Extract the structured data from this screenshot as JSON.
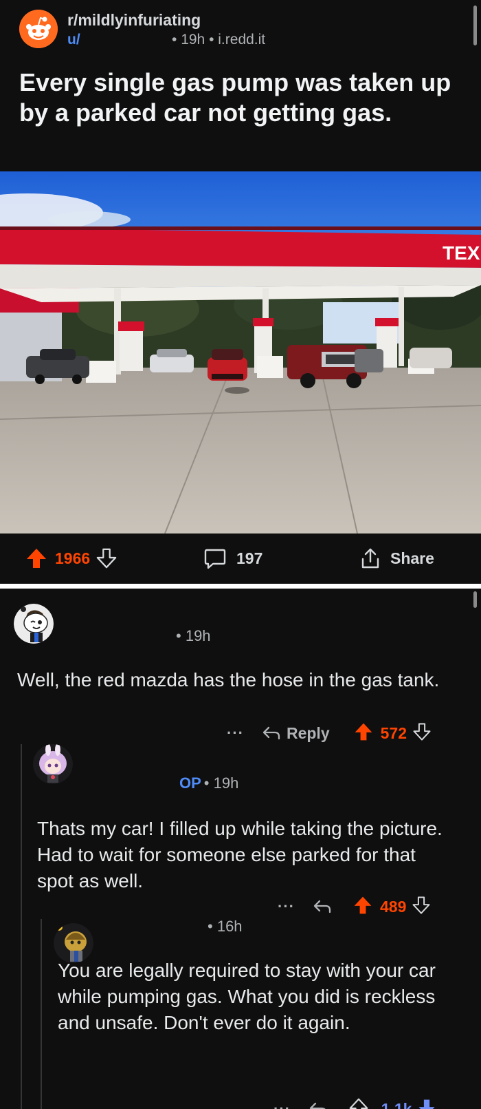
{
  "post": {
    "subreddit": "r/mildlyinfuriating",
    "user": "u/",
    "time": "19h",
    "domain": "i.redd.it",
    "title": "Every single gas pump was taken up by a parked car not getting gas.",
    "image_sign_text": "TEX",
    "upvotes": "1966",
    "comments": "197",
    "share_label": "Share"
  },
  "comments": [
    {
      "time": "19h",
      "body": "Well, the red mazda has the hose in the gas tank.",
      "more": "···",
      "reply_label": "Reply",
      "score": "572"
    },
    {
      "op_tag": "OP",
      "time": "19h",
      "body": "Thats my car! I filled up while taking the picture. Had to wait for someone else parked for that spot as well.",
      "more": "···",
      "score": "489"
    },
    {
      "time": "16h",
      "body": "You are legally required to stay with your car while pumping gas. What you did is reckless and unsafe. Don't ever do it again.",
      "more": "···",
      "score": "-1.1k"
    }
  ],
  "colors": {
    "upvote": "#ff4500",
    "downvote": "#6f8ef7",
    "link": "#4f8cf7",
    "background": "#0f0f10"
  },
  "icons": {
    "upvote": "arrow-up-icon",
    "downvote": "arrow-down-icon",
    "comments": "speech-bubble-icon",
    "share": "share-icon",
    "reply": "reply-arrow-icon"
  }
}
